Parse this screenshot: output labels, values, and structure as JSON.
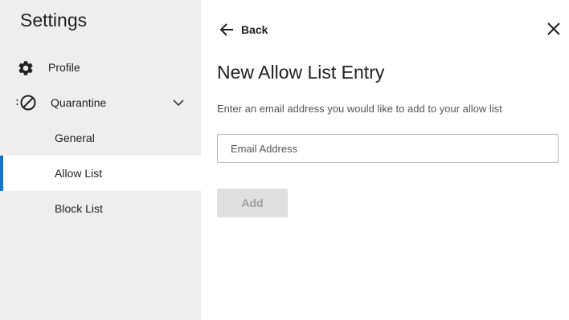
{
  "sidebar": {
    "title": "Settings",
    "profile": {
      "label": "Profile",
      "icon": "gear-icon"
    },
    "quarantine": {
      "label": "Quarantine",
      "icon": "prohibited-icon",
      "expanded": true
    },
    "sub_items": [
      {
        "label": "General",
        "active": false
      },
      {
        "label": "Allow List",
        "active": true
      },
      {
        "label": "Block List",
        "active": false
      }
    ],
    "active_color": "#1a73c7"
  },
  "header": {
    "back_label": "Back",
    "back_icon": "arrow-left-icon",
    "close_icon": "close-icon"
  },
  "main": {
    "title": "New Allow List Entry",
    "description": "Enter an email address you would like to add to your allow list",
    "email": {
      "value": "",
      "placeholder": "Email Address"
    },
    "add_label": "Add"
  }
}
